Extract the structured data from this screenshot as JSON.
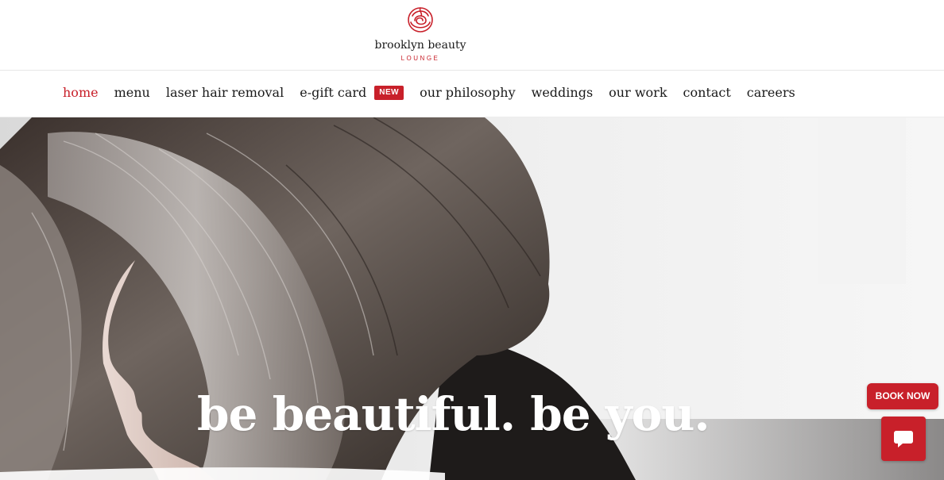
{
  "brand": {
    "name": "brooklyn beauty",
    "sub": "LOUNGE",
    "logo_icon": "rose-icon",
    "accent": "#c8202a"
  },
  "nav": {
    "items": [
      {
        "label": "home",
        "active": true
      },
      {
        "label": "menu"
      },
      {
        "label": "laser hair removal"
      },
      {
        "label": "e-gift card",
        "badge": "NEW"
      },
      {
        "label": "our philosophy"
      },
      {
        "label": "weddings"
      },
      {
        "label": "our work"
      },
      {
        "label": "contact"
      },
      {
        "label": "careers"
      }
    ]
  },
  "hero": {
    "headline": "be beautiful. be you."
  },
  "cta": {
    "book_now": "BOOK NOW",
    "chat_icon": "chat-bubble-icon"
  }
}
